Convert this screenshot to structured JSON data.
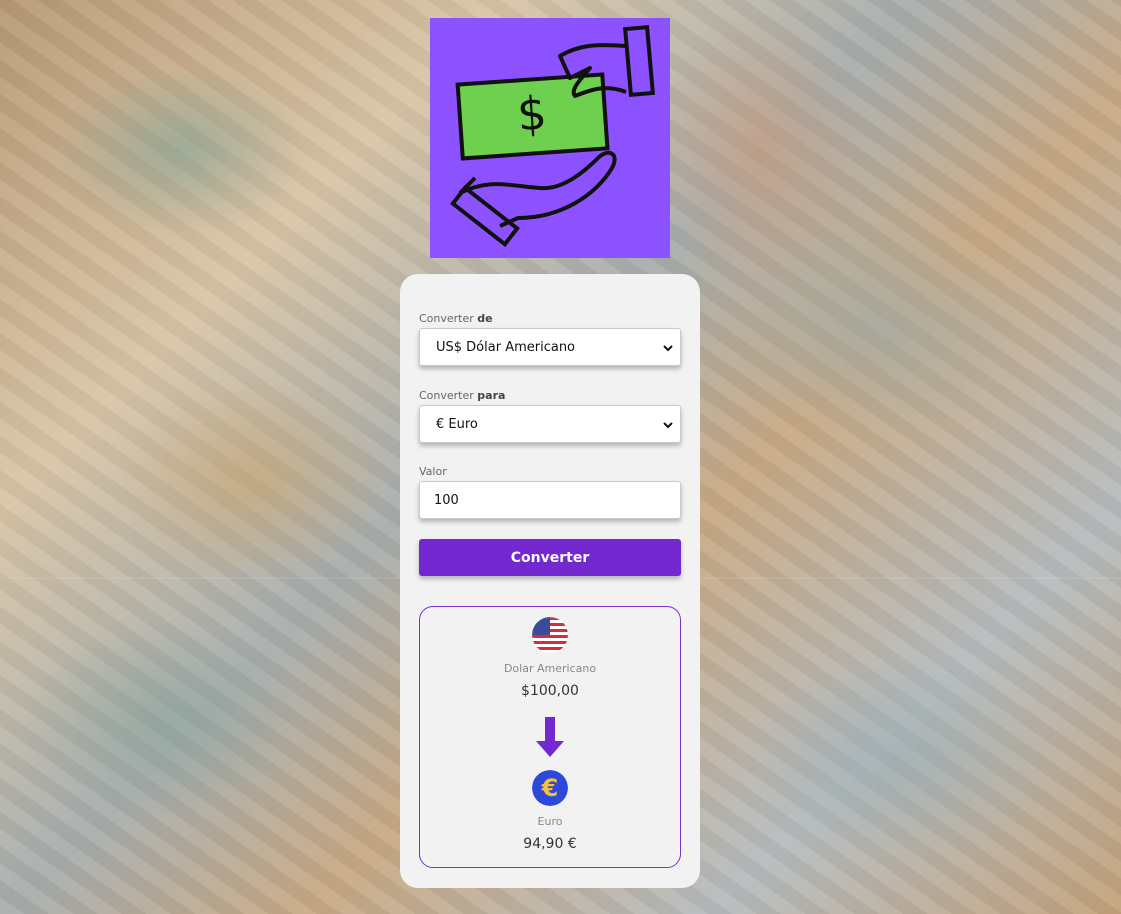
{
  "form": {
    "from_label": "Converter",
    "from_label_bold": "de",
    "from_selected": "US$ Dólar Americano",
    "to_label": "Converter",
    "to_label_bold": "para",
    "to_selected": "€ Euro",
    "value_label": "Valor",
    "value": "100",
    "convert_button": "Converter"
  },
  "result": {
    "from_currency_name": "Dolar Americano",
    "from_amount": "$100,00",
    "to_currency_name": "Euro",
    "to_amount": "94,90 €",
    "from_flag_icon": "us-flag-icon",
    "to_flag_icon": "euro-icon"
  },
  "colors": {
    "accent": "#7429d0",
    "logo_bg": "#8c52ff",
    "card_bg": "#f3f2f3"
  }
}
